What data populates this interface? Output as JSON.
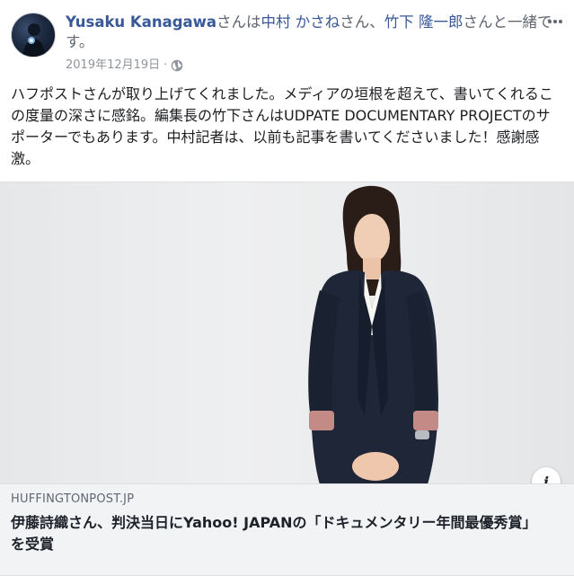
{
  "post": {
    "author": "Yusaku Kanagawa",
    "byline_text_1": "さんは",
    "tag_1": "中村 かさね",
    "byline_text_2": "さん、",
    "tag_2": "竹下 隆一郎",
    "byline_text_3": "さんと一緒です。",
    "date": "2019年12月19日",
    "separator": "·",
    "privacy_icon": "globe-icon",
    "more_icon": "ellipsis-icon",
    "body": "ハフポストさんが取り上げてくれました。メディアの垣根を超えて、書いてくれるこの度量の深さに感銘。編集長の竹下さんはUDPATE DOCUMENTARY PROJECTのサポーターでもあります。中村記者は、以前も記事を書いてくださいました！感謝感激。"
  },
  "link_preview": {
    "info_label": "i",
    "domain": "HUFFINGTONPOST.JP",
    "title": "伊藤詩織さん、判決当日にYahoo! JAPANの「ドキュメンタリー年間最優秀賞」を受賞"
  },
  "colors": {
    "link_blue": "#385898",
    "meta_gray": "#90949c",
    "card_bg": "#f2f3f5",
    "text": "#1c1e21"
  }
}
